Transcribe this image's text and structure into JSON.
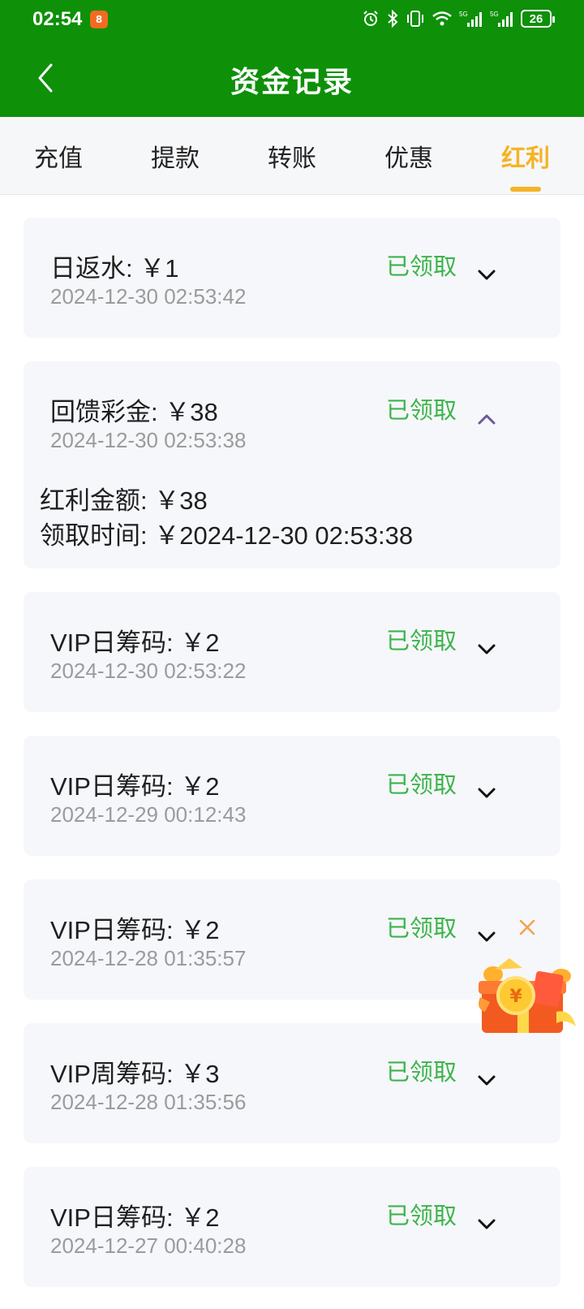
{
  "status_bar": {
    "time": "02:54",
    "battery": "26",
    "network_1": "5G",
    "network_2": "5G"
  },
  "header": {
    "title": "资金记录",
    "background_color": "#0e9009"
  },
  "tabs": [
    {
      "label": "充值",
      "active": false
    },
    {
      "label": "提款",
      "active": false
    },
    {
      "label": "转账",
      "active": false
    },
    {
      "label": "优惠",
      "active": false
    },
    {
      "label": "红利",
      "active": true
    }
  ],
  "accent_color": "#f5b325",
  "status_color": "#3cb44b",
  "records": [
    {
      "title": "日返水: ￥1",
      "time": "2024-12-30 02:53:42",
      "status": "已领取",
      "expanded": false
    },
    {
      "title": "回馈彩金: ￥38",
      "time": "2024-12-30 02:53:38",
      "status": "已领取",
      "expanded": true,
      "details": {
        "amount": "红利金额:  ￥38",
        "claim_time": "领取时间:  ￥2024-12-30 02:53:38"
      }
    },
    {
      "title": "VIP日筹码: ￥2",
      "time": "2024-12-30 02:53:22",
      "status": "已领取",
      "expanded": false
    },
    {
      "title": "VIP日筹码: ￥2",
      "time": "2024-12-29 00:12:43",
      "status": "已领取",
      "expanded": false
    },
    {
      "title": "VIP日筹码: ￥2",
      "time": "2024-12-28 01:35:57",
      "status": "已领取",
      "expanded": false
    },
    {
      "title": "VIP周筹码: ￥3",
      "time": "2024-12-28 01:35:56",
      "status": "已领取",
      "expanded": false
    },
    {
      "title": "VIP日筹码: ￥2",
      "time": "2024-12-27 00:40:28",
      "status": "已领取",
      "expanded": false
    }
  ],
  "icons": {
    "back": "chevron-left-icon",
    "expand": "chevron-down-icon",
    "collapse": "chevron-up-icon",
    "gift": "gift-box-icon",
    "close": "close-icon"
  }
}
